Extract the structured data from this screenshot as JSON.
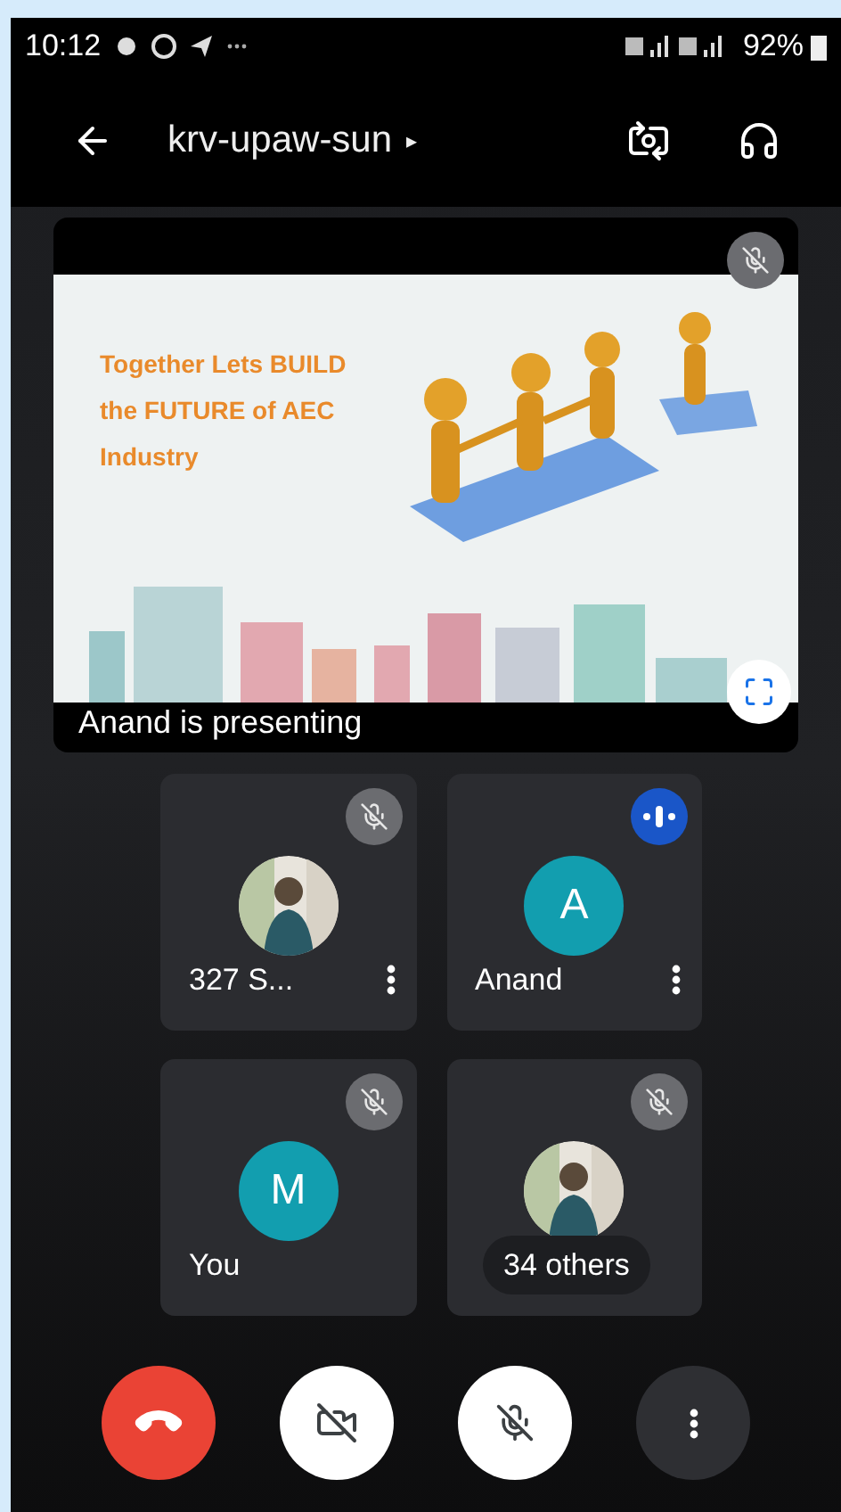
{
  "status_bar": {
    "time": "10:12",
    "battery": "92%"
  },
  "app_bar": {
    "title": "krv-upaw-sun",
    "caret": "▸"
  },
  "stage": {
    "muted": true,
    "slide": {
      "lines": [
        "Together Lets BUILD",
        "the FUTURE of AEC",
        "Industry"
      ]
    },
    "caption": "Anand is presenting"
  },
  "tiles": [
    {
      "name": "327 S...",
      "muted": true,
      "menu": true
    },
    {
      "name": "Anand",
      "muted": false,
      "avatar": {
        "kind": "initial",
        "letter": "A",
        "color": "#129eaf"
      },
      "menu": true
    },
    {
      "name": "You",
      "muted": true,
      "avatar": {
        "kind": "initial",
        "letter": "M",
        "color": "#129eaf"
      },
      "menu": false
    },
    {
      "muted": true,
      "menu": false,
      "overlay": "34 others"
    }
  ],
  "controls": [
    {
      "kind": "hangup"
    },
    {
      "kind": "camera",
      "on": false
    },
    {
      "kind": "mic",
      "on": false
    },
    {
      "kind": "more"
    }
  ]
}
